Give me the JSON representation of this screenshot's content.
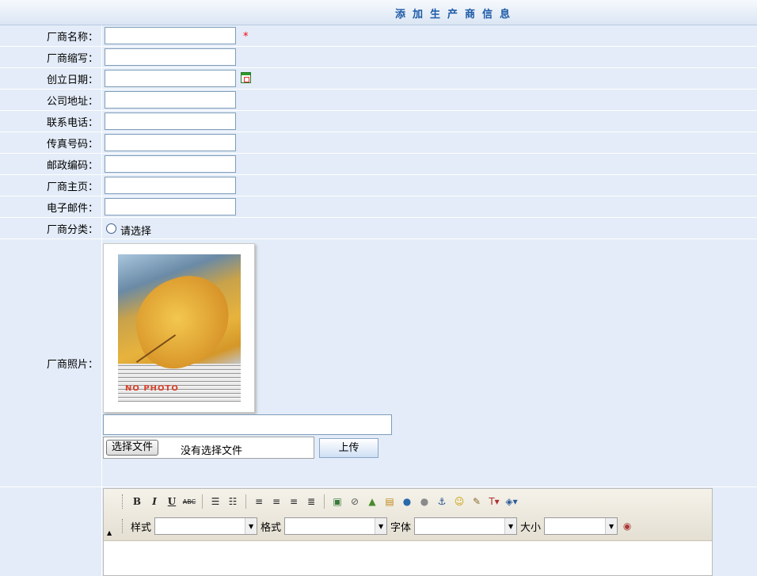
{
  "header": {
    "title": "添加生产商信息"
  },
  "fields": [
    {
      "label": "厂商名称：",
      "value": "",
      "required": "*"
    },
    {
      "label": "厂商缩写：",
      "value": ""
    },
    {
      "label": "创立日期：",
      "value": ""
    },
    {
      "label": "公司地址：",
      "value": ""
    },
    {
      "label": "联系电话：",
      "value": ""
    },
    {
      "label": "传真号码：",
      "value": ""
    },
    {
      "label": "邮政编码：",
      "value": ""
    },
    {
      "label": "厂商主页：",
      "value": ""
    },
    {
      "label": "电子邮件：",
      "value": ""
    }
  ],
  "category": {
    "label": "厂商分类：",
    "option": "请选择"
  },
  "photo": {
    "label": "厂商照片：",
    "placeholder_text": "NO PHOTO",
    "path_value": "",
    "file_button": "选择文件",
    "file_status": "没有选择文件",
    "upload_button": "上传"
  },
  "editor": {
    "toolbar_row1": [
      "B",
      "I",
      "U",
      "ABC",
      "ordered-list",
      "unordered-list",
      "align-left",
      "align-center",
      "align-right",
      "align-justify",
      "image",
      "flash",
      "media",
      "file",
      "link",
      "unlink",
      "anchor",
      "smiley",
      "special-char",
      "text-color",
      "bg-color"
    ],
    "style_label": "样式",
    "format_label": "格式",
    "font_label": "字体",
    "size_label": "大小"
  },
  "colors": {
    "background": "#e3ecf8",
    "title": "#1d5aa6",
    "required": "#ff0000"
  }
}
